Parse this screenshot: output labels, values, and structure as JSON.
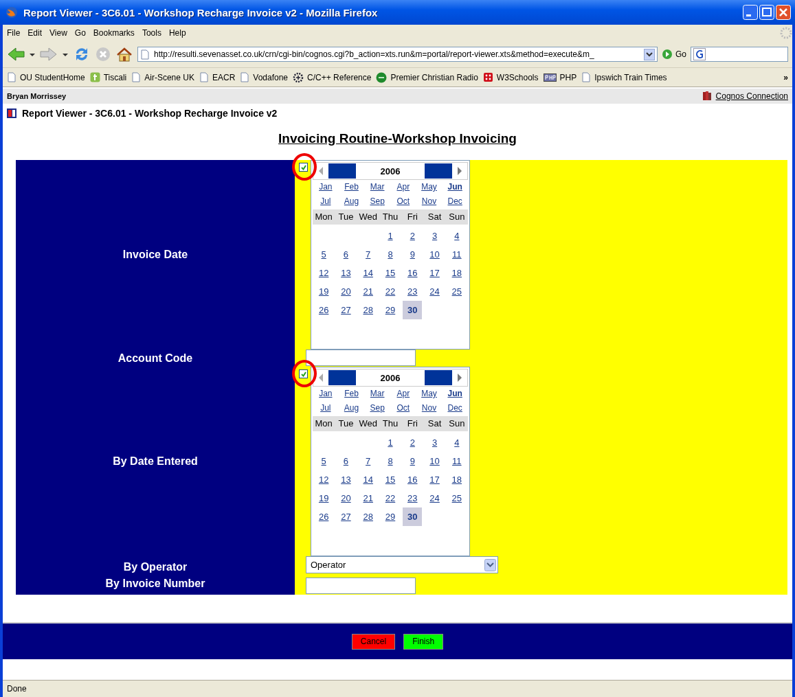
{
  "window": {
    "title": "Report Viewer - 3C6.01 - Workshop Recharge Invoice v2 - Mozilla Firefox"
  },
  "menu": [
    "File",
    "Edit",
    "View",
    "Go",
    "Bookmarks",
    "Tools",
    "Help"
  ],
  "navigation": {
    "address": "http://resulti.sevenasset.co.uk/crn/cgi-bin/cognos.cgi?b_action=xts.run&m=portal/report-viewer.xts&method=execute&m_",
    "go": "Go"
  },
  "bookmarks": [
    {
      "label": "OU StudentHome",
      "kind": "page"
    },
    {
      "label": "Tiscali",
      "kind": "tiscali"
    },
    {
      "label": "Air-Scene UK",
      "kind": "page"
    },
    {
      "label": "EACR",
      "kind": "page"
    },
    {
      "label": "Vodafone",
      "kind": "page"
    },
    {
      "label": "C/C++ Reference",
      "kind": "gear"
    },
    {
      "label": "Premier Christian Radio",
      "kind": "pmg"
    },
    {
      "label": "W3Schools",
      "kind": "dice"
    },
    {
      "label": "PHP",
      "kind": "php"
    },
    {
      "label": "Ipswich Train Times",
      "kind": "page"
    }
  ],
  "bookmarks_overflow": "»",
  "user": "Bryan Morrissey",
  "portal_link": "Cognos Connection",
  "report_title": "Report Viewer - 3C6.01 - Workshop Recharge Invoice v2",
  "heading": "Invoicing Routine-Workshop Invoicing",
  "fields": [
    {
      "label": "Invoice Date",
      "kind": "calendar",
      "checked": true,
      "circled": true,
      "year": "2006",
      "months": [
        {
          "label": "Jan",
          "selected": false
        },
        {
          "label": "Feb",
          "selected": false
        },
        {
          "label": "Mar",
          "selected": false
        },
        {
          "label": "Apr",
          "selected": false
        },
        {
          "label": "May",
          "selected": false
        },
        {
          "label": "Jun",
          "selected": true
        },
        {
          "label": "Jul",
          "selected": false
        },
        {
          "label": "Aug",
          "selected": false
        },
        {
          "label": "Sep",
          "selected": false
        },
        {
          "label": "Oct",
          "selected": false
        },
        {
          "label": "Nov",
          "selected": false
        },
        {
          "label": "Dec",
          "selected": false
        }
      ],
      "weekdays": [
        "Mon",
        "Tue",
        "Wed",
        "Thu",
        "Fri",
        "Sat",
        "Sun"
      ],
      "weeks": [
        {
          "right_aligned": true,
          "days": [
            {
              "label": "1",
              "selected": false
            },
            {
              "label": "2",
              "selected": false
            },
            {
              "label": "3",
              "selected": false
            },
            {
              "label": "4",
              "selected": false
            }
          ]
        },
        {
          "days": [
            {
              "label": "5",
              "selected": false
            },
            {
              "label": "6",
              "selected": false
            },
            {
              "label": "7",
              "selected": false
            },
            {
              "label": "8",
              "selected": false
            },
            {
              "label": "9",
              "selected": false
            },
            {
              "label": "10",
              "selected": false
            },
            {
              "label": "11",
              "selected": false
            }
          ]
        },
        {
          "days": [
            {
              "label": "12",
              "selected": false
            },
            {
              "label": "13",
              "selected": false
            },
            {
              "label": "14",
              "selected": false
            },
            {
              "label": "15",
              "selected": false
            },
            {
              "label": "16",
              "selected": false
            },
            {
              "label": "17",
              "selected": false
            },
            {
              "label": "18",
              "selected": false
            }
          ]
        },
        {
          "days": [
            {
              "label": "19",
              "selected": false
            },
            {
              "label": "20",
              "selected": false
            },
            {
              "label": "21",
              "selected": false
            },
            {
              "label": "22",
              "selected": false
            },
            {
              "label": "23",
              "selected": false
            },
            {
              "label": "24",
              "selected": false
            },
            {
              "label": "25",
              "selected": false
            }
          ]
        },
        {
          "right_aligned": false,
          "days": [
            {
              "label": "26",
              "selected": false
            },
            {
              "label": "27",
              "selected": false
            },
            {
              "label": "28",
              "selected": false
            },
            {
              "label": "29",
              "selected": false
            },
            {
              "label": "30",
              "selected": true
            }
          ]
        }
      ]
    },
    {
      "label": "Account Code",
      "kind": "text"
    },
    {
      "label": "By Date Entered",
      "kind": "calendar",
      "checked": true,
      "circled": true,
      "year": "2006",
      "months": [
        {
          "label": "Jan",
          "selected": false
        },
        {
          "label": "Feb",
          "selected": false
        },
        {
          "label": "Mar",
          "selected": false
        },
        {
          "label": "Apr",
          "selected": false
        },
        {
          "label": "May",
          "selected": false
        },
        {
          "label": "Jun",
          "selected": true
        },
        {
          "label": "Jul",
          "selected": false
        },
        {
          "label": "Aug",
          "selected": false
        },
        {
          "label": "Sep",
          "selected": false
        },
        {
          "label": "Oct",
          "selected": false
        },
        {
          "label": "Nov",
          "selected": false
        },
        {
          "label": "Dec",
          "selected": false
        }
      ],
      "weekdays": [
        "Mon",
        "Tue",
        "Wed",
        "Thu",
        "Fri",
        "Sat",
        "Sun"
      ],
      "weeks": [
        {
          "right_aligned": true,
          "days": [
            {
              "label": "1",
              "selected": false
            },
            {
              "label": "2",
              "selected": false
            },
            {
              "label": "3",
              "selected": false
            },
            {
              "label": "4",
              "selected": false
            }
          ]
        },
        {
          "days": [
            {
              "label": "5",
              "selected": false
            },
            {
              "label": "6",
              "selected": false
            },
            {
              "label": "7",
              "selected": false
            },
            {
              "label": "8",
              "selected": false
            },
            {
              "label": "9",
              "selected": false
            },
            {
              "label": "10",
              "selected": false
            },
            {
              "label": "11",
              "selected": false
            }
          ]
        },
        {
          "days": [
            {
              "label": "12",
              "selected": false
            },
            {
              "label": "13",
              "selected": false
            },
            {
              "label": "14",
              "selected": false
            },
            {
              "label": "15",
              "selected": false
            },
            {
              "label": "16",
              "selected": false
            },
            {
              "label": "17",
              "selected": false
            },
            {
              "label": "18",
              "selected": false
            }
          ]
        },
        {
          "days": [
            {
              "label": "19",
              "selected": false
            },
            {
              "label": "20",
              "selected": false
            },
            {
              "label": "21",
              "selected": false
            },
            {
              "label": "22",
              "selected": false
            },
            {
              "label": "23",
              "selected": false
            },
            {
              "label": "24",
              "selected": false
            },
            {
              "label": "25",
              "selected": false
            }
          ]
        },
        {
          "right_aligned": false,
          "days": [
            {
              "label": "26",
              "selected": false
            },
            {
              "label": "27",
              "selected": false
            },
            {
              "label": "28",
              "selected": false
            },
            {
              "label": "29",
              "selected": false
            },
            {
              "label": "30",
              "selected": true
            }
          ]
        }
      ]
    },
    {
      "label": "By Operator",
      "kind": "select",
      "value": "Operator"
    },
    {
      "label": "By Invoice Number",
      "kind": "text"
    }
  ],
  "buttons": [
    {
      "label": "Cancel",
      "kind": "cancel"
    },
    {
      "label": "Finish",
      "kind": "finish"
    }
  ],
  "status_bar": "Done"
}
